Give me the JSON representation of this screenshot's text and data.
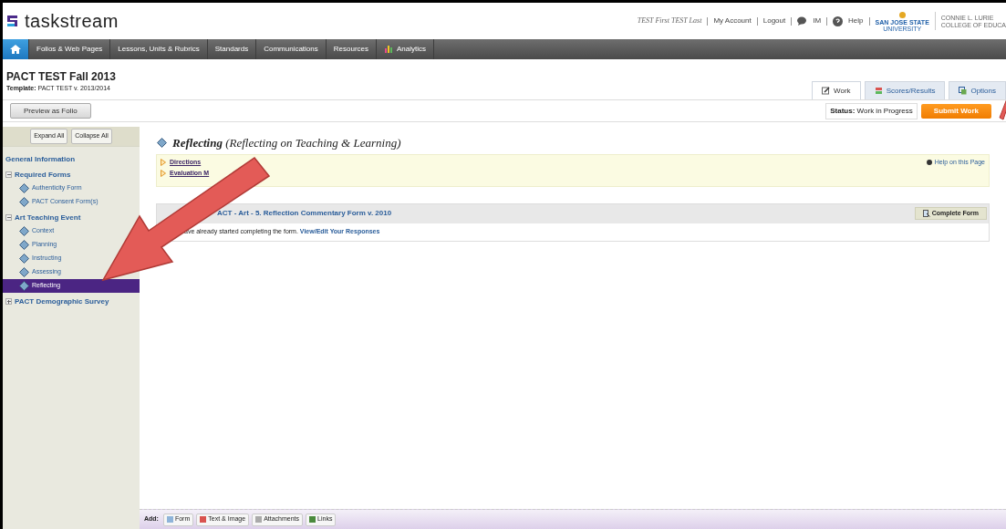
{
  "header": {
    "logo": "taskstream",
    "user": "TEST First TEST Last",
    "links": [
      {
        "label": "My Account",
        "kind": "text"
      },
      {
        "label": "Logout",
        "kind": "text"
      },
      {
        "label": "IM",
        "kind": "chat"
      },
      {
        "label": "Help",
        "kind": "help"
      }
    ],
    "university": {
      "name": "SAN JOSE STATE",
      "sub": "UNIVERSITY",
      "college_1": "CONNIE L. LURIE",
      "college_2": "COLLEGE OF EDUCA"
    }
  },
  "nav": [
    {
      "kind": "home",
      "selected": true
    },
    {
      "label": "Folios & Web Pages",
      "kind": "text",
      "selected": false
    },
    {
      "label": "Lessons, Units & Rubrics",
      "kind": "text",
      "selected": false
    },
    {
      "label": "Standards",
      "kind": "text",
      "selected": false
    },
    {
      "label": "Communications",
      "kind": "text",
      "selected": false
    },
    {
      "label": "Resources",
      "kind": "text",
      "selected": false
    },
    {
      "label": "Analytics",
      "kind": "chart",
      "selected": false
    }
  ],
  "page": {
    "title": "PACT TEST Fall 2013",
    "template_label": "Template:",
    "template": "PACT TEST v. 2013/2014",
    "preview_button": "Preview as Folio"
  },
  "tabs": [
    {
      "label": "Work",
      "selected": true
    },
    {
      "label": "Scores/Results",
      "selected": false
    },
    {
      "label": "Options",
      "selected": false
    }
  ],
  "status": {
    "label": "Status:",
    "value": "Work in Progress",
    "submit": "Submit Work"
  },
  "sidebar": {
    "expand": "Expand All",
    "collapse": "Collapse All",
    "items": [
      {
        "label": "General Information",
        "kind": "link"
      },
      {
        "label": "Required Forms",
        "kind": "group",
        "expanded": true,
        "children": [
          {
            "label": "Authenticity Form",
            "selected": false
          },
          {
            "label": "PACT Consent Form(s)",
            "selected": false
          }
        ]
      },
      {
        "label": "Art Teaching Event",
        "kind": "group",
        "expanded": true,
        "children": [
          {
            "label": "Context",
            "selected": false
          },
          {
            "label": "Planning",
            "selected": false
          },
          {
            "label": "Instructing",
            "selected": false
          },
          {
            "label": "Assessing",
            "selected": false
          },
          {
            "label": "Reflecting",
            "selected": true
          }
        ]
      },
      {
        "label": "PACT Demographic Survey",
        "kind": "group",
        "expanded": false
      }
    ]
  },
  "content": {
    "title": "Reflecting",
    "subtitle": "(Reflecting on Teaching & Learning)",
    "links": [
      "Directions",
      "Evaluation M"
    ],
    "help": "Help on this Page",
    "form": {
      "title": "ACT - Art - 5. Reflection Commentary Form v. 2010",
      "button": "Complete Form",
      "text": "ave already started completing the form.",
      "link": "View/Edit Your Responses"
    }
  },
  "add_bar": {
    "label": "Add:",
    "buttons": [
      "Form",
      "Text & Image",
      "Attachments",
      "Links"
    ]
  }
}
